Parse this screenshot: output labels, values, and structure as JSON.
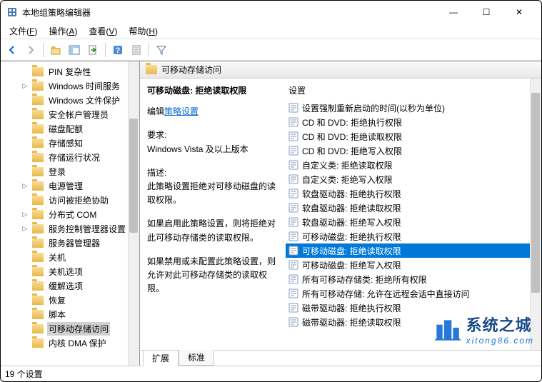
{
  "window": {
    "title": "本地组策略编辑器",
    "minimize": "—",
    "maximize": "☐",
    "close": "✕"
  },
  "menu": {
    "file": "文件(F)",
    "action": "操作(A)",
    "view": "查看(V)",
    "help": "帮助(H)"
  },
  "tree": {
    "items": [
      {
        "label": "PIN 复杂性",
        "exp": ""
      },
      {
        "label": "Windows 时间服务",
        "exp": "▷"
      },
      {
        "label": "Windows 文件保护",
        "exp": ""
      },
      {
        "label": "安全帐户管理员",
        "exp": ""
      },
      {
        "label": "磁盘配额",
        "exp": ""
      },
      {
        "label": "存储感知",
        "exp": ""
      },
      {
        "label": "存储运行状况",
        "exp": ""
      },
      {
        "label": "登录",
        "exp": ""
      },
      {
        "label": "电源管理",
        "exp": "▷"
      },
      {
        "label": "访问被拒绝协助",
        "exp": ""
      },
      {
        "label": "分布式 COM",
        "exp": "▷"
      },
      {
        "label": "服务控制管理器设置",
        "exp": "▷"
      },
      {
        "label": "服务器管理器",
        "exp": ""
      },
      {
        "label": "关机",
        "exp": ""
      },
      {
        "label": "关机选项",
        "exp": ""
      },
      {
        "label": "缓解选项",
        "exp": ""
      },
      {
        "label": "恢复",
        "exp": ""
      },
      {
        "label": "脚本",
        "exp": ""
      },
      {
        "label": "可移动存储访问",
        "exp": "",
        "selected": true
      },
      {
        "label": "内核 DMA 保护",
        "exp": ""
      }
    ]
  },
  "content": {
    "header": "可移动存储访问",
    "desc_title": "可移动磁盘: 拒绝读取权限",
    "edit_prefix": "编辑",
    "edit_link": "策略设置",
    "req_label": "要求:",
    "req_text": "Windows Vista 及以上版本",
    "desc_label": "描述:",
    "desc_text": "此策略设置拒绝对可移动磁盘的读取权限。",
    "para1": "如果启用此策略设置，则将拒绝对此可移动存储类的读取权限。",
    "para2": "如果禁用或未配置此策略设置，则允许对此可移动存储类的读取权限。"
  },
  "settings": {
    "header": "设置",
    "items": [
      {
        "label": "设置强制重新启动的时间(以秒为单位)"
      },
      {
        "label": "CD 和 DVD: 拒绝执行权限"
      },
      {
        "label": "CD 和 DVD: 拒绝读取权限"
      },
      {
        "label": "CD 和 DVD: 拒绝写入权限"
      },
      {
        "label": "自定义类: 拒绝读取权限"
      },
      {
        "label": "自定义类: 拒绝写入权限"
      },
      {
        "label": "软盘驱动器: 拒绝执行权限"
      },
      {
        "label": "软盘驱动器: 拒绝读取权限"
      },
      {
        "label": "软盘驱动器: 拒绝写入权限"
      },
      {
        "label": "可移动磁盘: 拒绝执行权限"
      },
      {
        "label": "可移动磁盘: 拒绝读取权限",
        "selected": true
      },
      {
        "label": "可移动磁盘: 拒绝写入权限"
      },
      {
        "label": "所有可移动存储类: 拒绝所有权限"
      },
      {
        "label": "所有可移动存储: 允许在远程会话中直接访问"
      },
      {
        "label": "磁带驱动器: 拒绝执行权限"
      },
      {
        "label": "磁带驱动器: 拒绝读取权限"
      }
    ]
  },
  "tabs": {
    "extended": "扩展",
    "standard": "标准"
  },
  "status": "19 个设置",
  "watermark": {
    "title": "系统之城",
    "url": "xitong86.com"
  }
}
